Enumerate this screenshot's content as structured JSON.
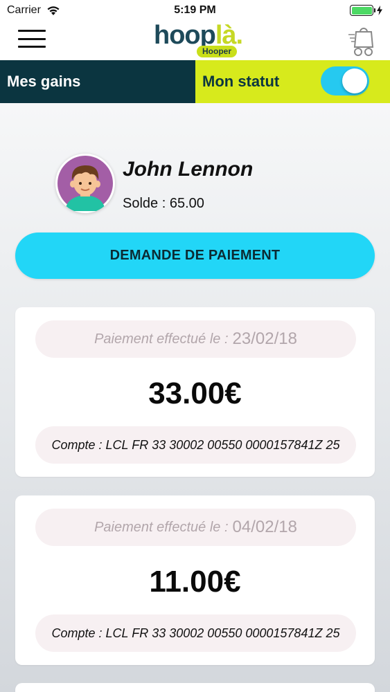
{
  "status_bar": {
    "carrier": "Carrier",
    "time": "5:19 PM",
    "battery_color": "#4cd964"
  },
  "nav": {
    "logo_main": "hoop",
    "logo_accent": "là.",
    "logo_badge": "Hooper",
    "menu_icon": "hamburger-menu-icon",
    "cart_icon": "shopping-cart-icon"
  },
  "tabs": {
    "gains_label": "Mes gains",
    "statut_label": "Mon statut",
    "statut_on": true
  },
  "profile": {
    "name": "John Lennon",
    "balance": "Solde : 65.00"
  },
  "actions": {
    "payment_request_label": "DEMANDE DE PAIEMENT"
  },
  "payments": [
    {
      "date_label": "Paiement effectué le :",
      "date": "23/02/18",
      "amount": "33.00€",
      "account": "Compte : LCL FR 33 30002 00550 0000157841Z 25"
    },
    {
      "date_label": "Paiement effectué le :",
      "date": "04/02/18",
      "amount": "11.00€",
      "account": "Compte : LCL FR 33 30002 00550 0000157841Z 25"
    }
  ],
  "colors": {
    "primary_dark": "#0b3540",
    "accent_lime": "#d7ea1c",
    "accent_cyan": "#22d6f7"
  }
}
